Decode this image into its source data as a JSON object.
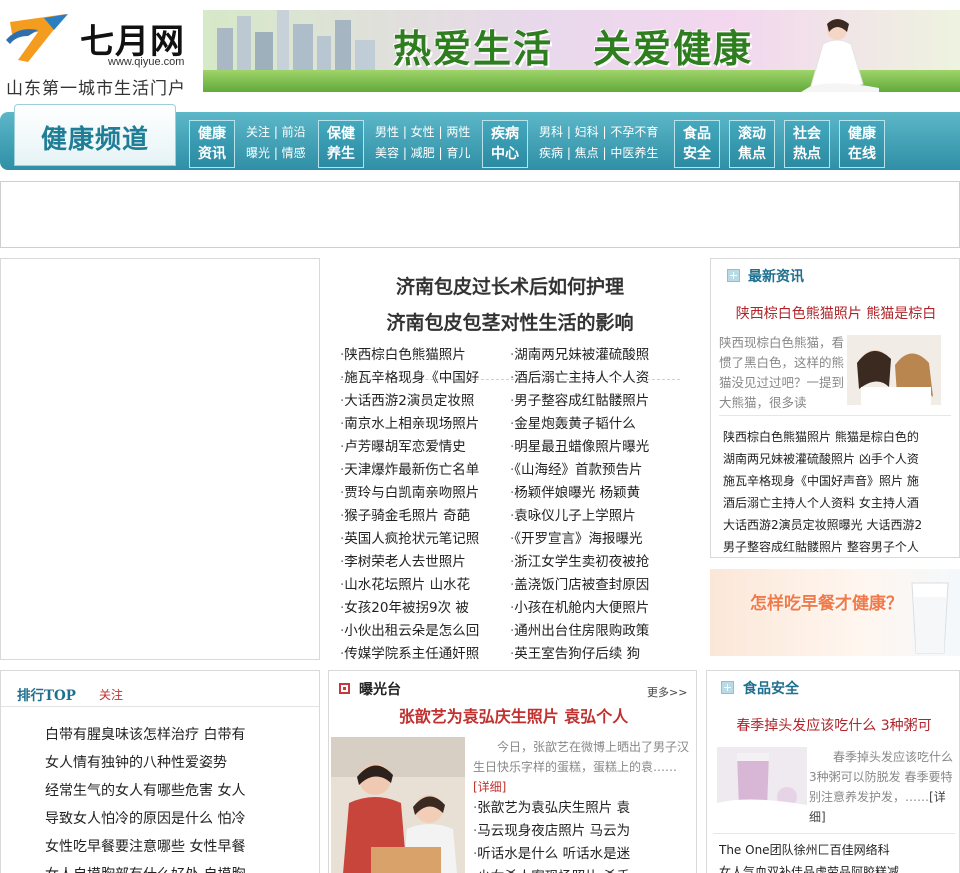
{
  "header": {
    "logo_name": "七月网",
    "logo_url": "www.qiyue.com",
    "slogan": "山东第一城市生活门户",
    "banner_text": "热爱生活　关爱健康"
  },
  "nav": {
    "channel_title": "健康频道",
    "main": [
      {
        "line1": "健康",
        "line2": "资讯"
      },
      {
        "line1": "保健",
        "line2": "养生"
      },
      {
        "line1": "疾病",
        "line2": "中心"
      },
      {
        "line1": "食品",
        "line2": "安全"
      },
      {
        "line1": "滚动",
        "line2": "焦点"
      },
      {
        "line1": "社会",
        "line2": "热点"
      },
      {
        "line1": "健康",
        "line2": "在线"
      }
    ],
    "sub_groups": [
      {
        "row1": "关注 | 前沿",
        "row2": "曝光 | 情感"
      },
      {
        "row1": "男性 | 女性 | 两性",
        "row2": "美容 | 减肥 | 育儿"
      },
      {
        "row1": "男科 | 妇科 | 不孕不育",
        "row2": "疾病 | 焦点 | 中医养生"
      }
    ]
  },
  "center": {
    "headline1": "济南包皮过长术后如何护理",
    "headline2": "济南包皮包茎对性生活的影响",
    "left_list": [
      "陕西棕白色熊猫照片",
      "施瓦辛格现身《中国好",
      "大话西游2演员定妆照",
      "南京水上相亲现场照片",
      "卢芳曝胡军恋爱情史",
      "天津爆炸最新伤亡名单",
      "贾玲与白凯南亲吻照片",
      "猴子骑金毛照片 奇葩",
      "英国人疯抢状元笔记照",
      "李树荣老人去世照片",
      "山水花坛照片 山水花",
      "女孩20年被拐9次 被",
      "小伙出租云朵是怎么回",
      "传媒学院系主任通奸照"
    ],
    "right_list": [
      "湖南两兄妹被灌硫酸照",
      "酒后溺亡主持人个人资",
      "男子整容成红骷髅照片",
      "金星炮轰黄子韬什么",
      "明星最丑蜡像照片曝光",
      "《山海经》首款预告片",
      "杨颖伴娘曝光 杨颖黄",
      "袁咏仪儿子上学照片",
      "《开罗宣言》海报曝光",
      "浙江女学生卖初夜被抢",
      "盖浇饭门店被查封原因",
      "小孩在机舱内大便照片",
      "通州出台住房限购政策",
      "英王室告狗仔后续 狗"
    ]
  },
  "latest": {
    "title": "最新资讯",
    "headline": "陕西棕白色熊猫照片 熊猫是棕白",
    "summary": "陕西现棕白色熊猫，看惯了黑白色，这样的熊猫没见过过吧？一提到大熊猫，很多读",
    "items": [
      "陕西棕白色熊猫照片 熊猫是棕白色的",
      "湖南两兄妹被灌硫酸照片 凶手个人资",
      "施瓦辛格现身《中国好声音》照片 施",
      "酒后溺亡主持人个人资料 女主持人酒",
      "大话西游2演员定妆照曝光 大话西游2",
      "男子整容成红骷髅照片 整容男子个人"
    ]
  },
  "breakfast_ad": {
    "text": "怎样吃早餐才健康？"
  },
  "rank": {
    "title": "排行TOP",
    "tab": "关注",
    "items": [
      "白带有腥臭味该怎样治疗 白带有",
      "女人情有独钟的八种性爱姿势",
      "经常生气的女人有哪些危害 女人",
      "导致女人怕冷的原因是什么 怕冷",
      "女性吃早餐要注意哪些 女性早餐",
      "女人自摸胸部有什么好处 自摸胸"
    ]
  },
  "expose": {
    "title": "曝光台",
    "more": "更多>>",
    "headline": "张歆艺为袁弘庆生照片 袁弘个人",
    "summary": "今日，张歆艺在微博上晒出了男子汉生日快乐字样的蛋糕，蛋糕上的袁……",
    "detail": "[详细]",
    "items": [
      "张歆艺为袁弘庆生照片 袁",
      "马云现身夜店照片 马云为",
      "听话水是什么 听话水是迷",
      "少女杀人案现场照片 杀手"
    ]
  },
  "food": {
    "title": "食品安全",
    "headline": "春季掉头发应该吃什么 3种粥可",
    "summary": "春季掉头发应该吃什么 3种粥可以防脱发 春季要特别注意养发护发，……",
    "detail": "[详细]",
    "items": [
      "The One团队徐州匚百佳网络科",
      "女人气血双补佳品虚劳品阿胶糕减"
    ]
  },
  "colors": {
    "nav_gradient_top": "#5cb7c8",
    "nav_gradient_bottom": "#2f8fa6",
    "accent_red": "#c0312f",
    "title_blue": "#1f6f8f"
  }
}
